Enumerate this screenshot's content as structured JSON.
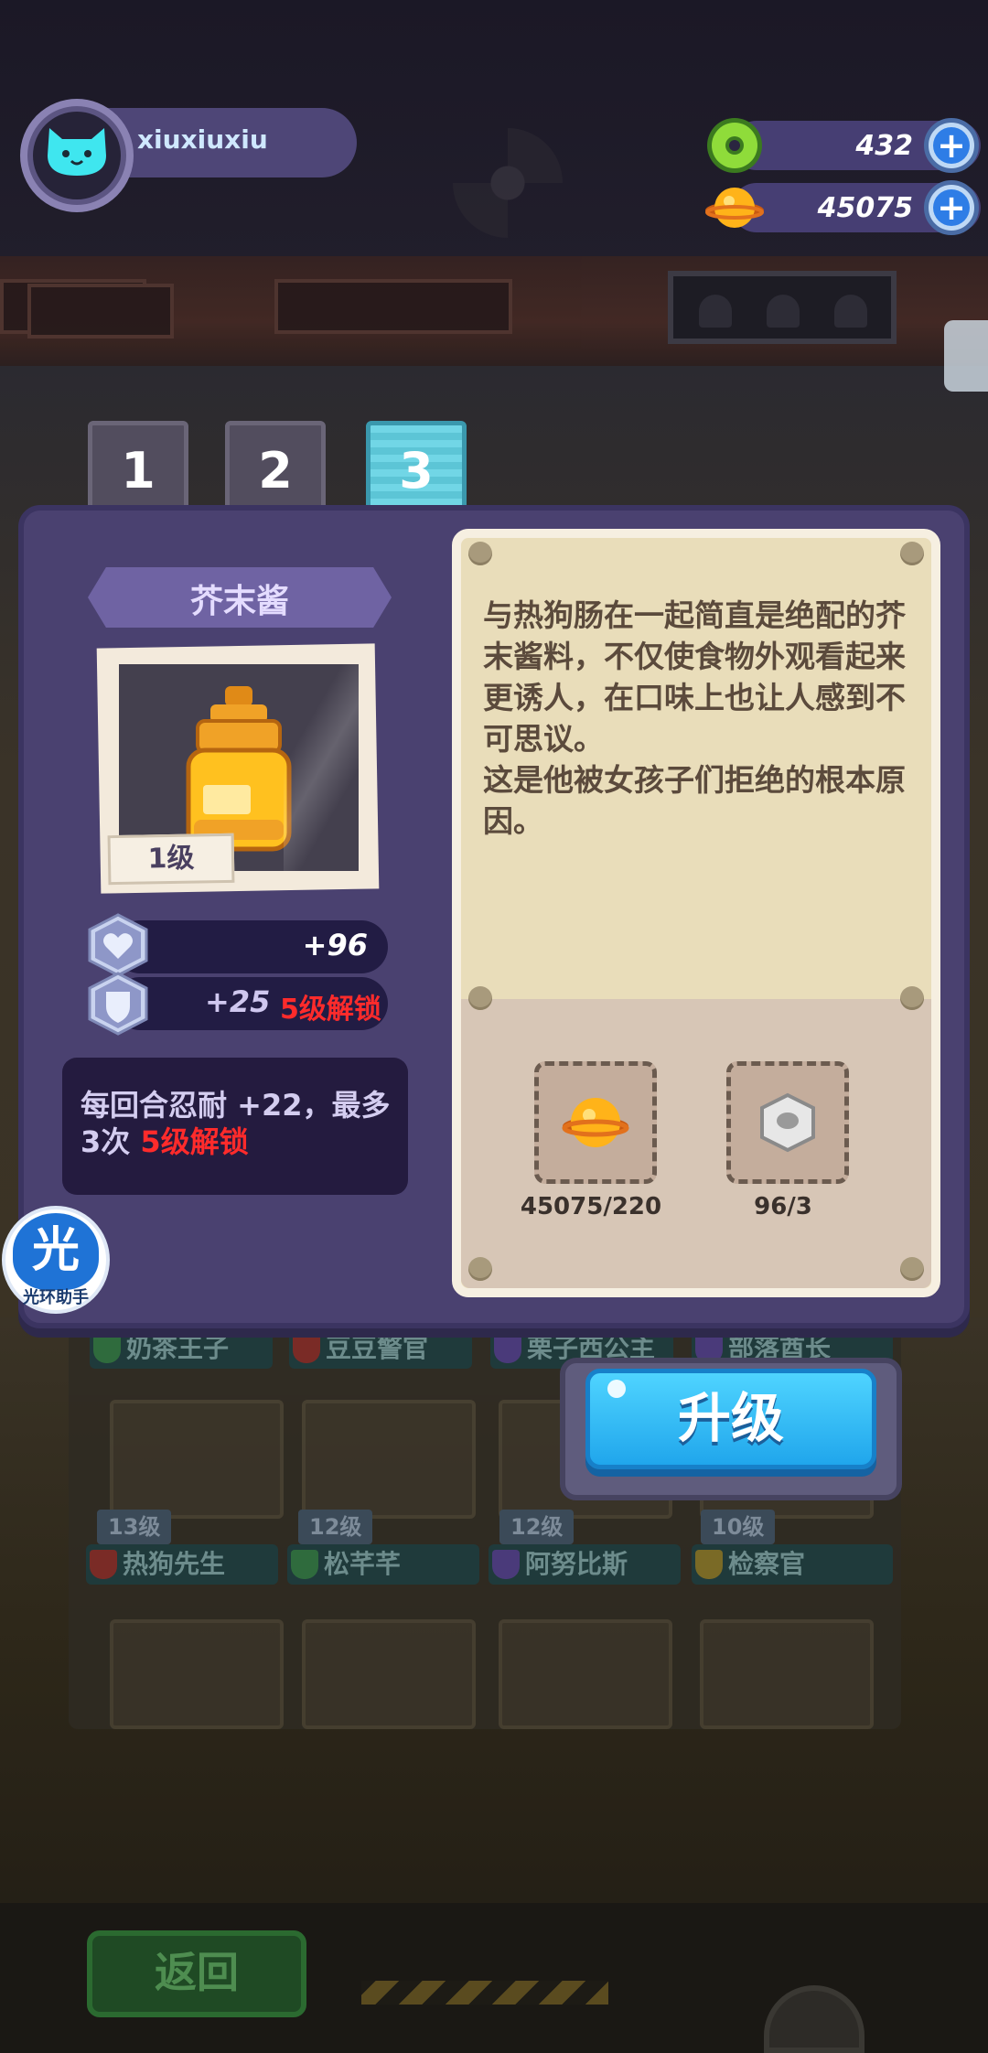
{
  "player": {
    "username": "xiuxiuxiu",
    "avatar_icon": "cat-face-icon"
  },
  "resources": [
    {
      "name": "donut",
      "icon": "donut-icon",
      "value": "432"
    },
    {
      "name": "coin",
      "icon": "planet-coin-icon",
      "value": "45075"
    }
  ],
  "tabs": [
    {
      "label": "1",
      "active": false
    },
    {
      "label": "2",
      "active": false
    },
    {
      "label": "3",
      "active": true
    }
  ],
  "item": {
    "name": "芥末酱",
    "level": "1级",
    "stats": [
      {
        "icon": "heart-icon",
        "value": "+96",
        "lock": ""
      },
      {
        "icon": "shield-icon",
        "value": "+25",
        "lock": "5级解锁"
      }
    ],
    "skill": {
      "text": "每回合忍耐 +22，最多3次 ",
      "lock": "5级解锁"
    },
    "description": "与热狗肠在一起简直是绝配的芥末酱料，不仅使食物外观看起来更诱人，在口味上也让人感到不可思议。\n这是他被女孩子们拒绝的根本原因。",
    "costs": [
      {
        "icon": "planet-coin-icon",
        "text": "45075/220"
      },
      {
        "icon": "hex-nut-icon",
        "text": "96/3"
      }
    ]
  },
  "upgrade_button": "升级",
  "helper": {
    "glyph": "光",
    "label": "光环助手"
  },
  "background": {
    "shelf_label": "芥末酱",
    "names_row1": [
      "奶茶王子",
      "豆豆警官",
      "栗子西公主",
      "部落酋长"
    ],
    "levels_row2": [
      "13级",
      "12级",
      "12级",
      "10级"
    ],
    "names_row2": [
      "热狗先生",
      "松芊芊",
      "阿努比斯",
      "检察官"
    ],
    "back_button": "返回"
  },
  "colors": {
    "accent_blue": "#2e7de6",
    "lock_red": "#ff2b2b",
    "dialog_purple": "#4a4170"
  }
}
